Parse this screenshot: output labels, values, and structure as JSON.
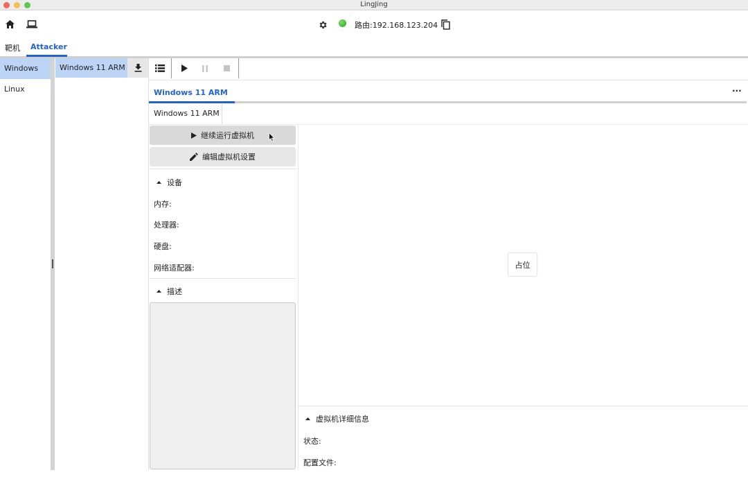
{
  "window": {
    "title": "LingJing"
  },
  "toolbar": {
    "route_label": "路由:192.168.123.204",
    "status_color": "#27a11a"
  },
  "outer_tabs": [
    {
      "label": "靶机",
      "active": false
    },
    {
      "label": "Attacker",
      "active": true
    }
  ],
  "categories": [
    {
      "label": "Windows",
      "selected": true
    },
    {
      "label": "Linux",
      "selected": false
    }
  ],
  "vm_list": [
    {
      "label": "Windows 11 ARM",
      "selected": true
    }
  ],
  "vm_tab": {
    "label": "Windows 11 ARM",
    "more": "···"
  },
  "sub_tab": {
    "label": "Windows 11 ARM"
  },
  "actions": {
    "resume_label": "继续运行虚拟机",
    "edit_label": "编辑虚拟机设置"
  },
  "devices": {
    "title": "设备",
    "memory": "内存:",
    "cpu": "处理器:",
    "disk": "硬盘:",
    "network": "网络适配器:"
  },
  "description": {
    "title": "描述"
  },
  "preview": {
    "placeholder": "占位"
  },
  "details": {
    "title": "虚拟机详细信息",
    "status": "状态:",
    "config": "配置文件:"
  },
  "colors": {
    "accent": "#1e63d6",
    "selection": "#bcd4f5"
  }
}
